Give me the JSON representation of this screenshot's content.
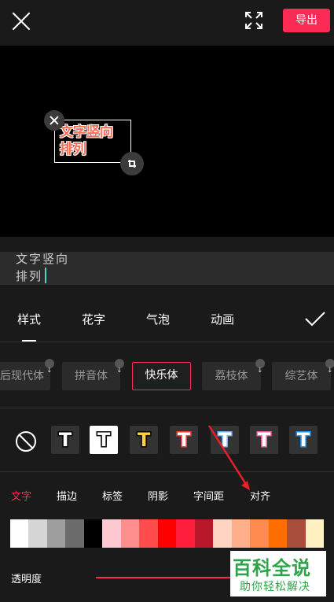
{
  "header": {
    "close_icon": "close-icon",
    "fullscreen_icon": "fullscreen-icon",
    "export_label": "导出",
    "accent": "#fc2b55"
  },
  "preview": {
    "text_line1": "文字竖向",
    "text_line2": "排列",
    "text_color": "#ff6a55"
  },
  "input": {
    "line1": "文字竖向",
    "line2": "排列",
    "caret_color": "#4dd2c7"
  },
  "tabs": [
    "样式",
    "花字",
    "气泡",
    "动画"
  ],
  "fonts": [
    "后现代体",
    "拼音体",
    "快乐体",
    "荔枝体",
    "综艺体"
  ],
  "selected_font": "快乐体",
  "text_styles": [
    {
      "fill": "#ffffff",
      "stroke": "#000000",
      "bg": "#333333"
    },
    {
      "fill": "#ffffff",
      "stroke": "#000000",
      "bg": "#ffffff"
    },
    {
      "fill": "#ffd23f",
      "stroke": "#000000",
      "bg": "#333333"
    },
    {
      "fill": "#ffffff",
      "stroke": "#ff3b3b",
      "bg": "#333333"
    },
    {
      "fill": "#ffffff",
      "stroke": "#7fb3ff",
      "bg": "#333333"
    },
    {
      "fill": "#ffffff",
      "stroke": "#ff66aa",
      "bg": "#333333"
    },
    {
      "fill": "#ffffff",
      "stroke": "#2196f3",
      "bg": "#333333"
    }
  ],
  "subtabs": [
    "文字",
    "描边",
    "标签",
    "阴影",
    "字间距",
    "对齐"
  ],
  "active_subtab_color": "#fc2b55",
  "palette": [
    "#ffffff",
    "#d6d6d6",
    "#9e9e9e",
    "#6b6b6b",
    "#000000",
    "#ffc9d1",
    "#ff8f8f",
    "#ff4d4d",
    "#ff0000",
    "#ff1f3c",
    "#b8182a",
    "#ffd5c2",
    "#ffb08a",
    "#ff8a4d",
    "#ff6e00",
    "#a84e3c",
    "#fff1c2"
  ],
  "opacity_label": "透明度",
  "watermark": {
    "title": "百科全说",
    "sub": "助你轻松解决"
  }
}
